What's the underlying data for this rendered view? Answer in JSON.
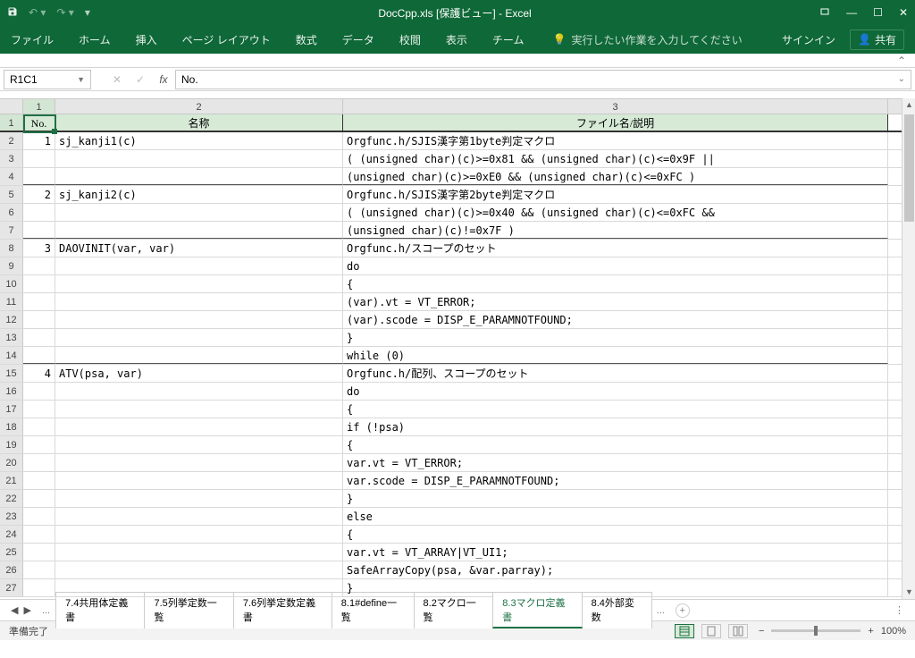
{
  "title": "DocCpp.xls  [保護ビュー] - Excel",
  "ribbon": {
    "tabs": [
      "ファイル",
      "ホーム",
      "挿入",
      "ページ レイアウト",
      "数式",
      "データ",
      "校閲",
      "表示",
      "チーム"
    ],
    "tell": "実行したい作業を入力してください",
    "signin": "サインイン",
    "share": "共有"
  },
  "namebox": "R1C1",
  "formula": "No.",
  "col_headers": [
    "1",
    "2",
    "3"
  ],
  "header_row": {
    "no": "No.",
    "name": "名称",
    "desc": "ファイル名/説明"
  },
  "rows": [
    {
      "r": "2",
      "no": "1",
      "name": "sj_kanji1(c)",
      "desc": "Orgfunc.h/SJIS漢字第1byte判定マクロ"
    },
    {
      "r": "3",
      "no": "",
      "name": "",
      "desc": "  ( (unsigned char)(c)>=0x81 && (unsigned char)(c)<=0x9F ||"
    },
    {
      "r": "4",
      "no": "",
      "name": "",
      "desc": "   (unsigned char)(c)>=0xE0 && (unsigned char)(c)<=0xFC )",
      "end": true
    },
    {
      "r": "5",
      "no": "2",
      "name": "sj_kanji2(c)",
      "desc": "Orgfunc.h/SJIS漢字第2byte判定マクロ"
    },
    {
      "r": "6",
      "no": "",
      "name": "",
      "desc": "  ( (unsigned char)(c)>=0x40 && (unsigned char)(c)<=0xFC &&"
    },
    {
      "r": "7",
      "no": "",
      "name": "",
      "desc": "   (unsigned char)(c)!=0x7F )",
      "end": true
    },
    {
      "r": "8",
      "no": "3",
      "name": "DAOVINIT(var, var)",
      "desc": "Orgfunc.h/スコープのセット"
    },
    {
      "r": "9",
      "no": "",
      "name": "",
      "desc": "    do"
    },
    {
      "r": "10",
      "no": "",
      "name": "",
      "desc": "    {"
    },
    {
      "r": "11",
      "no": "",
      "name": "",
      "desc": "    (var).vt = VT_ERROR;"
    },
    {
      "r": "12",
      "no": "",
      "name": "",
      "desc": "    (var).scode = DISP_E_PARAMNOTFOUND;"
    },
    {
      "r": "13",
      "no": "",
      "name": "",
      "desc": "    }"
    },
    {
      "r": "14",
      "no": "",
      "name": "",
      "desc": "    while (0)",
      "end": true
    },
    {
      "r": "15",
      "no": "4",
      "name": "ATV(psa, var)",
      "desc": "Orgfunc.h/配列、スコープのセット"
    },
    {
      "r": "16",
      "no": "",
      "name": "",
      "desc": "    do"
    },
    {
      "r": "17",
      "no": "",
      "name": "",
      "desc": "    {"
    },
    {
      "r": "18",
      "no": "",
      "name": "",
      "desc": "    if (!psa)"
    },
    {
      "r": "19",
      "no": "",
      "name": "",
      "desc": "    {"
    },
    {
      "r": "20",
      "no": "",
      "name": "",
      "desc": "    var.vt  = VT_ERROR;"
    },
    {
      "r": "21",
      "no": "",
      "name": "",
      "desc": "    var.scode = DISP_E_PARAMNOTFOUND;"
    },
    {
      "r": "22",
      "no": "",
      "name": "",
      "desc": "    }"
    },
    {
      "r": "23",
      "no": "",
      "name": "",
      "desc": "    else"
    },
    {
      "r": "24",
      "no": "",
      "name": "",
      "desc": "    {"
    },
    {
      "r": "25",
      "no": "",
      "name": "",
      "desc": "    var.vt  = VT_ARRAY|VT_UI1;"
    },
    {
      "r": "26",
      "no": "",
      "name": "",
      "desc": "    SafeArrayCopy(psa, &var.parray);"
    },
    {
      "r": "27",
      "no": "",
      "name": "",
      "desc": "    }"
    }
  ],
  "sheets": [
    "7.4共用体定義書",
    "7.5列挙定数一覧",
    "7.6列挙定数定義書",
    "8.1#define一覧",
    "8.2マクロ一覧",
    "8.3マクロ定義書",
    "8.4外部変数"
  ],
  "active_sheet": 5,
  "status": "準備完了",
  "zoom": "100%"
}
